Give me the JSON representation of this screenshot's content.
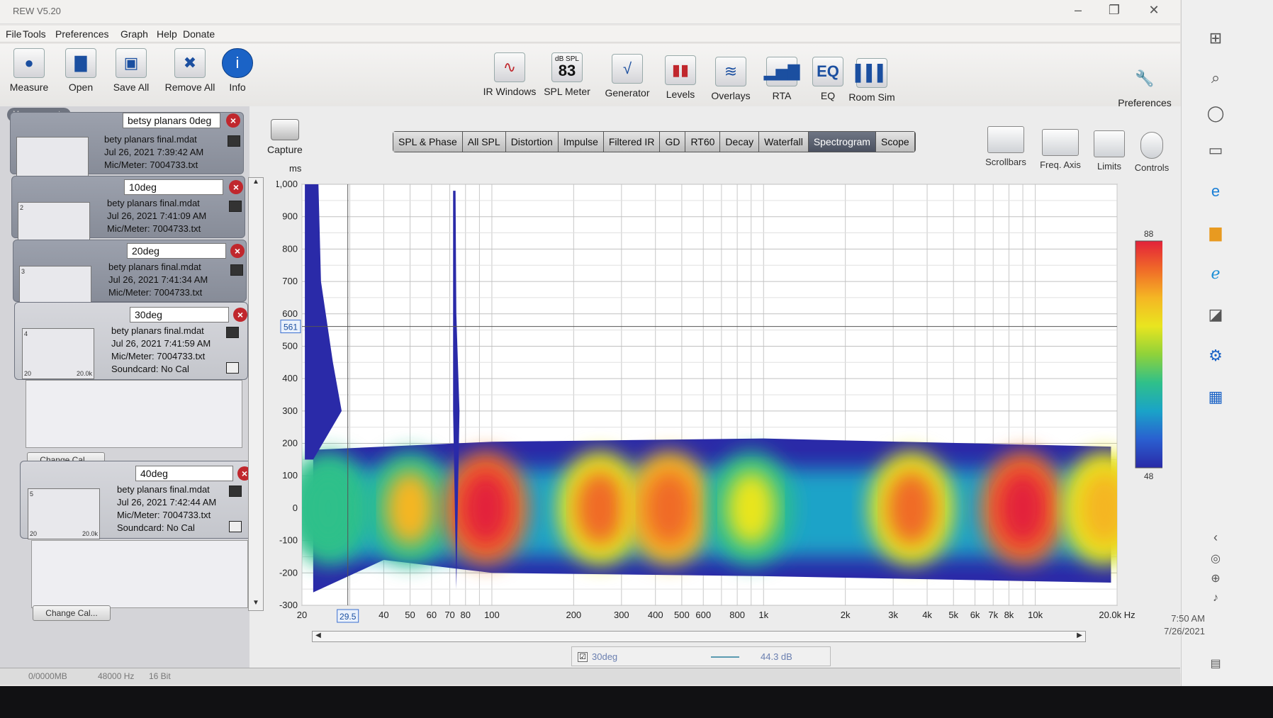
{
  "window": {
    "title": "REW V5.20"
  },
  "menu": [
    "File",
    "Tools",
    "Preferences",
    "Graph",
    "Help",
    "Donate"
  ],
  "toolbar_left": [
    {
      "label": "Measure",
      "icon": "measure-icon"
    },
    {
      "label": "Open",
      "icon": "folder-icon"
    },
    {
      "label": "Save All",
      "icon": "save-icon"
    },
    {
      "label": "Remove All",
      "icon": "remove-icon"
    },
    {
      "label": "Info",
      "icon": "info-icon"
    }
  ],
  "toolbar_center": [
    {
      "label": "IR Windows",
      "icon": "ir-windows-icon"
    },
    {
      "label": "SPL Meter",
      "icon": "spl-meter-icon",
      "badge_top": "dB SPL",
      "badge_value": "83"
    },
    {
      "label": "Generator",
      "icon": "generator-icon"
    },
    {
      "label": "Levels",
      "icon": "levels-icon"
    },
    {
      "label": "Overlays",
      "icon": "overlays-icon"
    },
    {
      "label": "RTA",
      "icon": "rta-icon"
    },
    {
      "label": "EQ",
      "icon": "eq-icon"
    },
    {
      "label": "Room Sim",
      "icon": "room-sim-icon"
    }
  ],
  "preferences_label": "Preferences",
  "capture_label": "Capture",
  "right_tools": [
    "Scrollbars",
    "Freq. Axis",
    "Limits",
    "Controls"
  ],
  "measurements_header": "Measurements",
  "measurements": [
    {
      "num": "",
      "name": "betsy planars 0deg",
      "file": "bety planars final.mdat",
      "date": "Jul 26, 2021 7:39:42 AM",
      "mic": "Mic/Meter: 7004733.txt",
      "soundcard": ""
    },
    {
      "num": "2",
      "name": "10deg",
      "file": "bety planars final.mdat",
      "date": "Jul 26, 2021 7:41:09 AM",
      "mic": "Mic/Meter: 7004733.txt",
      "soundcard": ""
    },
    {
      "num": "3",
      "name": "20deg",
      "file": "bety planars final.mdat",
      "date": "Jul 26, 2021 7:41:34 AM",
      "mic": "Mic/Meter: 7004733.txt",
      "soundcard": ""
    },
    {
      "num": "4",
      "name": "30deg",
      "file": "bety planars final.mdat",
      "date": "Jul 26, 2021 7:41:59 AM",
      "mic": "Mic/Meter: 7004733.txt",
      "soundcard": "Soundcard: No Cal"
    },
    {
      "num": "5",
      "name": "40deg",
      "file": "bety planars final.mdat",
      "date": "Jul 26, 2021 7:42:44 AM",
      "mic": "Mic/Meter: 7004733.txt",
      "soundcard": "Soundcard: No Cal"
    }
  ],
  "thumb_ticks": [
    "20",
    "20.0k"
  ],
  "change_cal_label": "Change Cal...",
  "graph_tabs": [
    "SPL & Phase",
    "All SPL",
    "Distortion",
    "Impulse",
    "Filtered IR",
    "GD",
    "RT60",
    "Decay",
    "Waterfall",
    "Spectrogram",
    "Scope"
  ],
  "active_tab": "Spectrogram",
  "chart_data": {
    "type": "heatmap",
    "ylabel": "ms",
    "y_ticks": [
      "1,000",
      "900",
      "800",
      "700",
      "600",
      "500",
      "400",
      "300",
      "200",
      "100",
      "0",
      "-100",
      "-200",
      "-300"
    ],
    "ylim": [
      -300,
      1000
    ],
    "x_scale": "log",
    "xlim": [
      20,
      20000
    ],
    "x_ticks": [
      {
        "v": 20,
        "label": "20"
      },
      {
        "v": 40,
        "label": "40"
      },
      {
        "v": 50,
        "label": "50"
      },
      {
        "v": 60,
        "label": "60"
      },
      {
        "v": 70,
        "label": "70"
      },
      {
        "v": 80,
        "label": "80"
      },
      {
        "v": 100,
        "label": "100"
      },
      {
        "v": 200,
        "label": "200"
      },
      {
        "v": 300,
        "label": "300"
      },
      {
        "v": 400,
        "label": "400"
      },
      {
        "v": 500,
        "label": "500"
      },
      {
        "v": 600,
        "label": "600"
      },
      {
        "v": 800,
        "label": "800"
      },
      {
        "v": 1000,
        "label": "1k"
      },
      {
        "v": 2000,
        "label": "2k"
      },
      {
        "v": 3000,
        "label": "3k"
      },
      {
        "v": 4000,
        "label": "4k"
      },
      {
        "v": 5000,
        "label": "5k"
      },
      {
        "v": 6000,
        "label": "6k"
      },
      {
        "v": 7000,
        "label": "7k"
      },
      {
        "v": 8000,
        "label": "8k"
      },
      {
        "v": 10000,
        "label": "10k"
      },
      {
        "v": 20000,
        "label": "20.0k Hz"
      }
    ],
    "cursor": {
      "x": 29.5,
      "x_label": "29.5",
      "y": 561,
      "y_label": "561"
    },
    "colorscale": {
      "max": "88",
      "min": "48",
      "colors": [
        "#e3213a",
        "#f06a28",
        "#f5b624",
        "#e9e51f",
        "#8fd23a",
        "#2fc08a",
        "#1aa3c8",
        "#2a5fd0",
        "#2a2aa8"
      ]
    },
    "energy_bands": [
      {
        "f": 25,
        "level": 0.55
      },
      {
        "f": 50,
        "level": 0.75
      },
      {
        "f": 95,
        "level": 1.0
      },
      {
        "f": 250,
        "level": 0.85
      },
      {
        "f": 450,
        "level": 0.9
      },
      {
        "f": 900,
        "level": 0.7
      },
      {
        "f": 3500,
        "level": 0.85
      },
      {
        "f": 9000,
        "level": 1.0
      },
      {
        "f": 18000,
        "level": 0.8
      }
    ]
  },
  "legend": {
    "checked": "☑",
    "name": "30deg",
    "value": "44.3 dB"
  },
  "status": {
    "a": "0/0000MB",
    "b": "48000 Hz",
    "c": "16 Bit"
  },
  "clock": {
    "time": "7:50 AM",
    "date": "7/26/2021"
  }
}
